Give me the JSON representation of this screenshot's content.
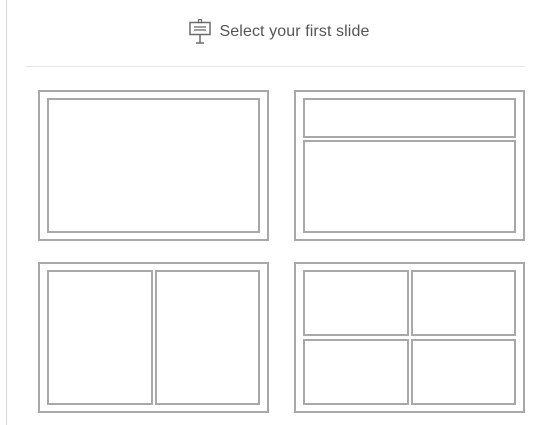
{
  "header": {
    "icon": "presentation-board-icon",
    "title": "Select your first slide"
  },
  "layouts": [
    {
      "name": "layout-single-frame",
      "zones": 1
    },
    {
      "name": "layout-title-and-body",
      "zones": 2
    },
    {
      "name": "layout-two-columns",
      "zones": 2
    },
    {
      "name": "layout-four-grid",
      "zones": 4
    }
  ],
  "colors": {
    "outline": "#a8a8a8",
    "title_text": "#555555",
    "divider": "#e6e6e6"
  }
}
